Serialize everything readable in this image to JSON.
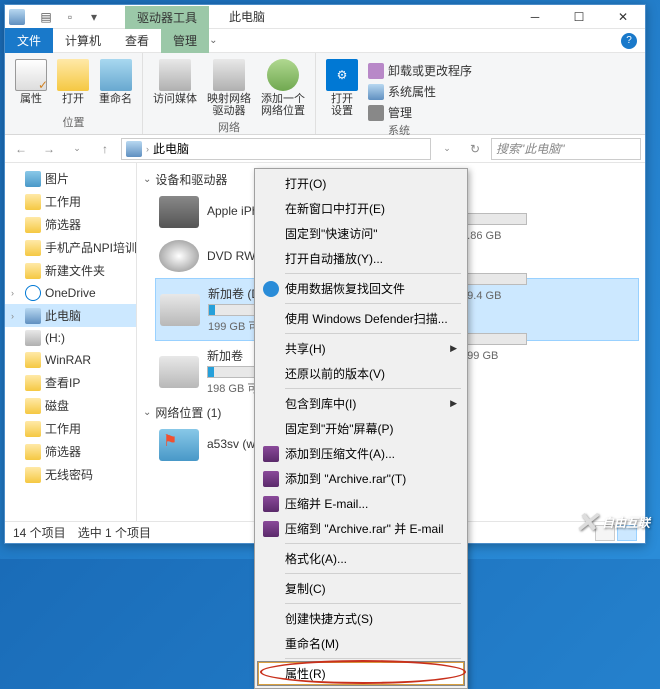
{
  "titlebar": {
    "tool_tab": "驱动器工具",
    "title": "此电脑"
  },
  "ribbon_tabs": {
    "file": "文件",
    "computer": "计算机",
    "view": "查看",
    "manage": "管理"
  },
  "ribbon": {
    "group_loc": {
      "properties": "属性",
      "open": "打开",
      "rename": "重命名",
      "name": "位置"
    },
    "group_net": {
      "media": "访问媒体",
      "mapdrive": "映射网络\n驱动器",
      "addloc": "添加一个\n网络位置",
      "name": "网络"
    },
    "group_sys": {
      "settings": "打开\n设置",
      "uninstall": "卸载或更改程序",
      "sysprop": "系统属性",
      "manage": "管理",
      "name": "系统"
    }
  },
  "address": {
    "path": "此电脑",
    "search_placeholder": "搜索\"此电脑\""
  },
  "sidebar": {
    "items": [
      {
        "label": "图片",
        "icon": "img"
      },
      {
        "label": "工作用",
        "icon": "folder"
      },
      {
        "label": "筛选器",
        "icon": "folder"
      },
      {
        "label": "手机产品NPI培训",
        "icon": "folder"
      },
      {
        "label": "新建文件夹",
        "icon": "folder"
      },
      {
        "label": "OneDrive",
        "icon": "cloud",
        "level": 1
      },
      {
        "label": "此电脑",
        "icon": "pc",
        "level": 1,
        "active": true
      },
      {
        "label": "(H:)",
        "icon": "disk"
      },
      {
        "label": "WinRAR",
        "icon": "folder"
      },
      {
        "label": "查看IP",
        "icon": "folder"
      },
      {
        "label": "磁盘",
        "icon": "folder"
      },
      {
        "label": "工作用",
        "icon": "folder"
      },
      {
        "label": "筛选器",
        "icon": "folder"
      },
      {
        "label": "无线密码",
        "icon": "folder"
      }
    ]
  },
  "content": {
    "sec_devices": "设备和驱动器",
    "sec_network": "网络位置 (1)",
    "drives": [
      {
        "name": "Apple iPhone",
        "stats": "",
        "type": "phone"
      },
      {
        "name": "DVD RW 驱动器",
        "stats": "",
        "type": "dvd"
      },
      {
        "name": "新加卷 (D:)",
        "stats": "199 GB 可用",
        "type": "hdd",
        "selected": true
      },
      {
        "name": "新加卷",
        "stats": "198 GB 可用",
        "type": "hdd"
      }
    ],
    "extra_drives": [
      {
        "stats": "共 1.86 GB"
      },
      {
        "stats": "共 99.4 GB"
      },
      {
        "stats": "共 199 GB"
      }
    ],
    "net_item": "a53sv (w..."
  },
  "context_menu": {
    "items": [
      {
        "label": "打开(O)"
      },
      {
        "label": "在新窗口中打开(E)"
      },
      {
        "label": "固定到\"快速访问\""
      },
      {
        "label": "打开自动播放(Y)..."
      },
      {
        "sep": true
      },
      {
        "label": "使用数据恢复找回文件",
        "icon": "recover"
      },
      {
        "sep": true
      },
      {
        "label": "使用 Windows Defender扫描..."
      },
      {
        "sep": true
      },
      {
        "label": "共享(H)",
        "arrow": true
      },
      {
        "label": "还原以前的版本(V)"
      },
      {
        "sep": true
      },
      {
        "label": "包含到库中(I)",
        "arrow": true
      },
      {
        "label": "固定到\"开始\"屏幕(P)"
      },
      {
        "label": "添加到压缩文件(A)...",
        "icon": "rar"
      },
      {
        "label": "添加到 \"Archive.rar\"(T)",
        "icon": "rar"
      },
      {
        "label": "压缩并 E-mail...",
        "icon": "rar"
      },
      {
        "label": "压缩到 \"Archive.rar\" 并 E-mail",
        "icon": "rar"
      },
      {
        "sep": true
      },
      {
        "label": "格式化(A)..."
      },
      {
        "sep": true
      },
      {
        "label": "复制(C)"
      },
      {
        "sep": true
      },
      {
        "label": "创建快捷方式(S)"
      },
      {
        "label": "重命名(M)"
      },
      {
        "sep": true
      },
      {
        "label": "属性(R)",
        "highlighted": true
      }
    ]
  },
  "statusbar": {
    "count": "14 个项目",
    "selected": "选中 1 个项目"
  },
  "watermark": "自由互联"
}
